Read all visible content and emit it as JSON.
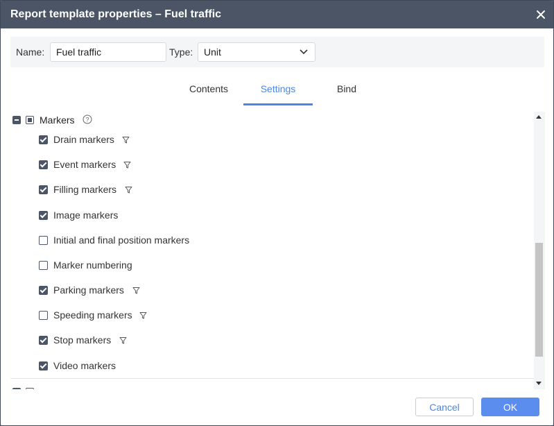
{
  "dialog": {
    "title": "Report template properties – Fuel traffic",
    "close_icon": "close-icon"
  },
  "form": {
    "name_label": "Name:",
    "name_value": "Fuel traffic",
    "type_label": "Type:",
    "type_value": "Unit"
  },
  "tabs": [
    {
      "label": "Contents",
      "active": false
    },
    {
      "label": "Settings",
      "active": true
    },
    {
      "label": "Bind",
      "active": false
    }
  ],
  "markers_group": {
    "label": "Markers",
    "state": "partial",
    "help_icon": "help-circle-icon",
    "items": [
      {
        "label": "Drain markers",
        "checked": true,
        "filter": true
      },
      {
        "label": "Event markers",
        "checked": true,
        "filter": true
      },
      {
        "label": "Filling markers",
        "checked": true,
        "filter": true
      },
      {
        "label": "Image markers",
        "checked": true,
        "filter": false
      },
      {
        "label": "Initial and final position markers",
        "checked": false,
        "filter": false
      },
      {
        "label": "Marker numbering",
        "checked": false,
        "filter": false
      },
      {
        "label": "Parking markers",
        "checked": true,
        "filter": true
      },
      {
        "label": "Speeding markers",
        "checked": false,
        "filter": true
      },
      {
        "label": "Stop markers",
        "checked": true,
        "filter": true
      },
      {
        "label": "Video markers",
        "checked": true,
        "filter": false
      }
    ]
  },
  "footer": {
    "cancel_label": "Cancel",
    "ok_label": "OK"
  },
  "colors": {
    "accent": "#4a86e8",
    "titlebar": "#4b5565",
    "ok_button": "#5b8def"
  }
}
